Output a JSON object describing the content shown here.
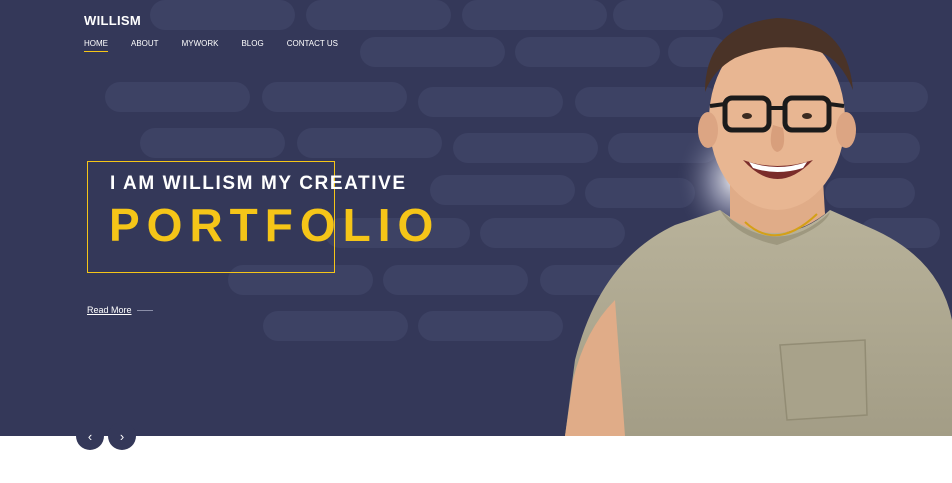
{
  "brand": {
    "logo": "WILLISM"
  },
  "nav": {
    "items": [
      {
        "label": "HOME",
        "active": true
      },
      {
        "label": "ABOUT",
        "active": false
      },
      {
        "label": "MYWORK",
        "active": false
      },
      {
        "label": "BLOG",
        "active": false
      },
      {
        "label": "CONTACT US",
        "active": false
      }
    ]
  },
  "hero": {
    "tagline": "I AM WILLISM MY CREATIVE",
    "headline": "PORTFOLIO",
    "read_more": "Read More"
  },
  "slider": {
    "prev_icon": "chevron-left-icon",
    "next_icon": "chevron-right-icon"
  },
  "colors": {
    "background": "#343859",
    "accent": "#f5c518",
    "text": "#ffffff",
    "page": "#ffffff"
  }
}
